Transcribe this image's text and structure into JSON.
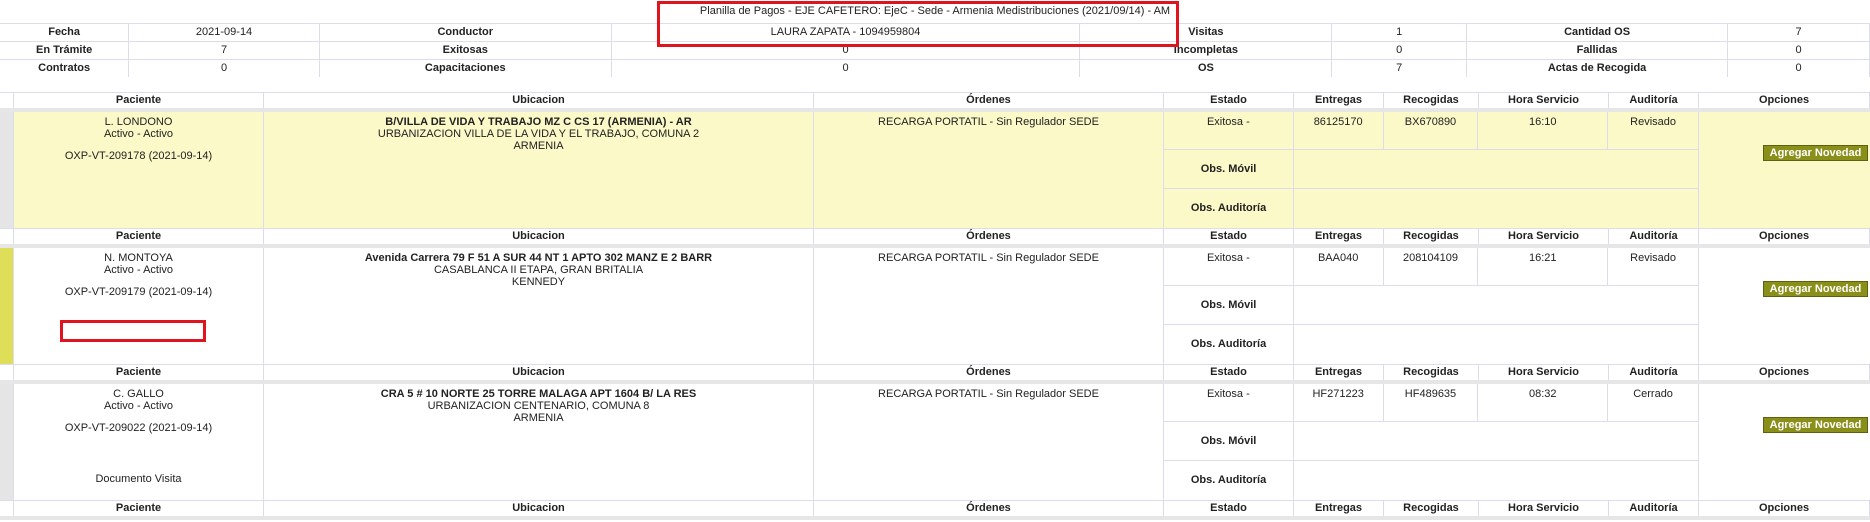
{
  "summary": {
    "title": "Planilla de Pagos - EJE CAFETERO: EjeC - Sede - Armenia Medistribuciones (2021/09/14) - AM",
    "rows": [
      {
        "l1": "Fecha",
        "v1": "2021-09-14",
        "l2": "Conductor",
        "v2": "LAURA ZAPATA - 1094959804",
        "l3": "Visitas",
        "v3": "1",
        "l4": "Cantidad OS",
        "v4": "7"
      },
      {
        "l1": "En Trámite",
        "v1": "7",
        "l2": "Exitosas",
        "v2": "0",
        "l3": "Incompletas",
        "v3": "0",
        "l4": "Fallidas",
        "v4": "0"
      },
      {
        "l1": "Contratos",
        "v1": "0",
        "l2": "Capacitaciones",
        "v2": "0",
        "l3": "OS",
        "v3": "7",
        "l4": "Actas de Recogida",
        "v4": "0"
      }
    ]
  },
  "columns": {
    "paciente": "Paciente",
    "ubicacion": "Ubicacion",
    "ordenes": "Órdenes",
    "estado": "Estado",
    "entregas": "Entregas",
    "recogidas": "Recogidas",
    "hora": "Hora Servicio",
    "auditoria": "Auditoría",
    "opciones": "Opciones"
  },
  "obs_movil_label": "Obs. Móvil",
  "obs_auditoria_label": "Obs. Auditoría",
  "novedad_button": "Agregar Novedad",
  "records": [
    {
      "name": "L. LONDONO",
      "state": "Activo - Activo",
      "code": "OXP-VT-209178 (2021-09-14)",
      "doc": "",
      "ubi1": "B/VILLA DE VIDA Y TRABAJO MZ C CS 17 (ARMENIA) - AR",
      "ubi2": "URBANIZACION VILLA DE LA VIDA Y EL TRABAJO, COMUNA 2",
      "ubi3": "ARMENIA",
      "orden": "RECARGA PORTATIL - Sin Regulador SEDE",
      "estado": "Exitosa -",
      "entregas": "86125170",
      "recogidas": "BX670890",
      "hora": "16:10",
      "auditoria": "Revisado"
    },
    {
      "name": "N. MONTOYA",
      "state": "Activo - Activo",
      "code": "OXP-VT-209179 (2021-09-14)",
      "doc": "",
      "ubi1": "Avenida Carrera 79 F 51 A SUR 44 NT 1 APTO 302 MANZ E 2 BARR",
      "ubi2": "CASABLANCA II ETAPA, GRAN BRITALIA",
      "ubi3": "KENNEDY",
      "orden": "RECARGA PORTATIL - Sin Regulador SEDE",
      "estado": "Exitosa -",
      "entregas": "BAA040",
      "recogidas": "208104109",
      "hora": "16:21",
      "auditoria": "Revisado"
    },
    {
      "name": "C. GALLO",
      "state": "Activo - Activo",
      "code": "OXP-VT-209022 (2021-09-14)",
      "doc": "Documento Visita",
      "ubi1": "CRA 5 # 10 NORTE 25 TORRE MALAGA APT 1604 B/ LA RES",
      "ubi2": "URBANIZACION CENTENARIO, COMUNA 8",
      "ubi3": "ARMENIA",
      "orden": "RECARGA PORTATIL - Sin Regulador SEDE",
      "estado": "Exitosa -",
      "entregas": "HF271223",
      "recogidas": "HF489635",
      "hora": "08:32",
      "auditoria": "Cerrado"
    }
  ]
}
